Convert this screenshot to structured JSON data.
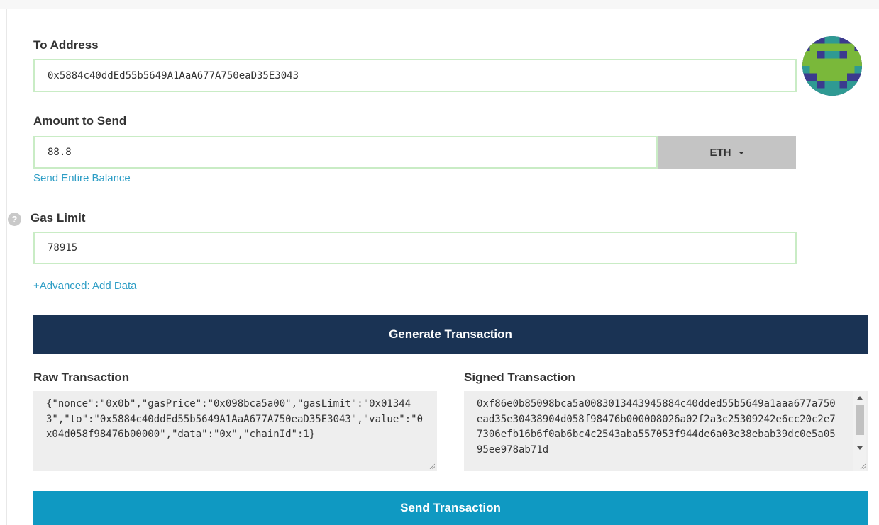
{
  "to_address": {
    "label": "To Address",
    "value": "0x5884c40ddEd55b5649A1AaA677A750eaD35E3043"
  },
  "amount": {
    "label": "Amount to Send",
    "value": "88.8",
    "unit": "ETH",
    "send_entire_balance": "Send Entire Balance"
  },
  "gas": {
    "help_glyph": "?",
    "label": "Gas Limit",
    "value": "78915"
  },
  "advanced_link": "+Advanced: Add Data",
  "generate_button": "Generate Transaction",
  "raw": {
    "label": "Raw Transaction",
    "value": "{\"nonce\":\"0x0b\",\"gasPrice\":\"0x098bca5a00\",\"gasLimit\":\"0x013443\",\"to\":\"0x5884c40ddEd55b5649A1AaA677A750eaD35E3043\",\"value\":\"0x04d058f98476b00000\",\"data\":\"0x\",\"chainId\":1}"
  },
  "signed": {
    "label": "Signed Transaction",
    "value": "0xf86e0b85098bca5a0083013443945884c40dded55b5649a1aaa677a750ead35e30438904d058f98476b000008026a02f2a3c25309242e6cc20c2e77306efb16b6f0ab6bc4c2543aba557053f944de6a03e38ebab39dc0e5a0595ee978ab71d"
  },
  "send_button": "Send Transaction",
  "colors": {
    "field_border": "#c9ecc5",
    "link": "#2d9dc5",
    "generate_bg": "#1a3354",
    "send_bg": "#0f99c2",
    "dropdown_bg": "#c4c4c4"
  }
}
